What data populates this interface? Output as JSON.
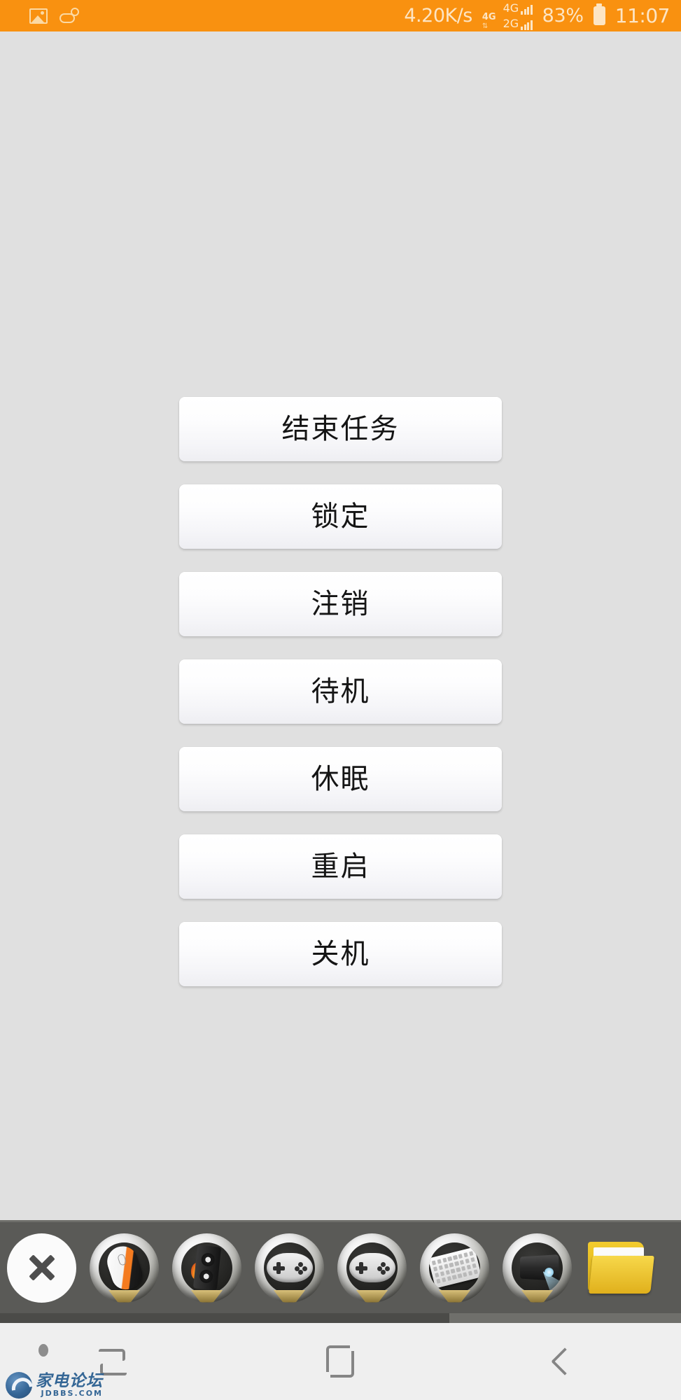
{
  "status_bar": {
    "background_color": "#f99110",
    "text_color": "#fde5c4",
    "left_icons": [
      {
        "name": "photo-icon",
        "label": "photo"
      },
      {
        "name": "weather-icon",
        "label": "weather"
      }
    ],
    "network_speed": "4.20K/s",
    "signal_primary": "4G",
    "signal_secondary_top": "4G",
    "signal_secondary_bottom": "2G",
    "data_arrows": "⇅",
    "battery_percent": "83%",
    "time": "11:07"
  },
  "main": {
    "background_color": "#e0e0e0",
    "buttons": [
      {
        "label": "结束任务",
        "name": "end-task-button"
      },
      {
        "label": "锁定",
        "name": "lock-button"
      },
      {
        "label": "注销",
        "name": "logoff-button"
      },
      {
        "label": "待机",
        "name": "standby-button"
      },
      {
        "label": "休眠",
        "name": "hibernate-button"
      },
      {
        "label": "重启",
        "name": "restart-button"
      },
      {
        "label": "关机",
        "name": "shutdown-button"
      }
    ]
  },
  "dock": {
    "background_color": "#5a5a57",
    "items": [
      {
        "name": "close-icon",
        "label": "关闭"
      },
      {
        "name": "mouse-icon",
        "label": "鼠标"
      },
      {
        "name": "speaker-icon",
        "label": "音量"
      },
      {
        "name": "gamepad-icon",
        "label": "游戏手柄"
      },
      {
        "name": "gamepad-icon-2",
        "label": "游戏手柄"
      },
      {
        "name": "keyboard-icon",
        "label": "键盘"
      },
      {
        "name": "projector-icon",
        "label": "投影"
      },
      {
        "name": "folder-icon",
        "label": "文件夹"
      }
    ],
    "scroll_thumb_percent": "66%"
  },
  "nav_bar": {
    "background_color": "#efefef",
    "buttons": [
      {
        "name": "recents-button",
        "label": "最近任务"
      },
      {
        "name": "home-button",
        "label": "主屏幕"
      },
      {
        "name": "back-button",
        "label": "返回"
      }
    ]
  },
  "watermark": {
    "chinese": "家电论坛",
    "english": "JDBBS.COM",
    "color": "#2a5f91"
  }
}
